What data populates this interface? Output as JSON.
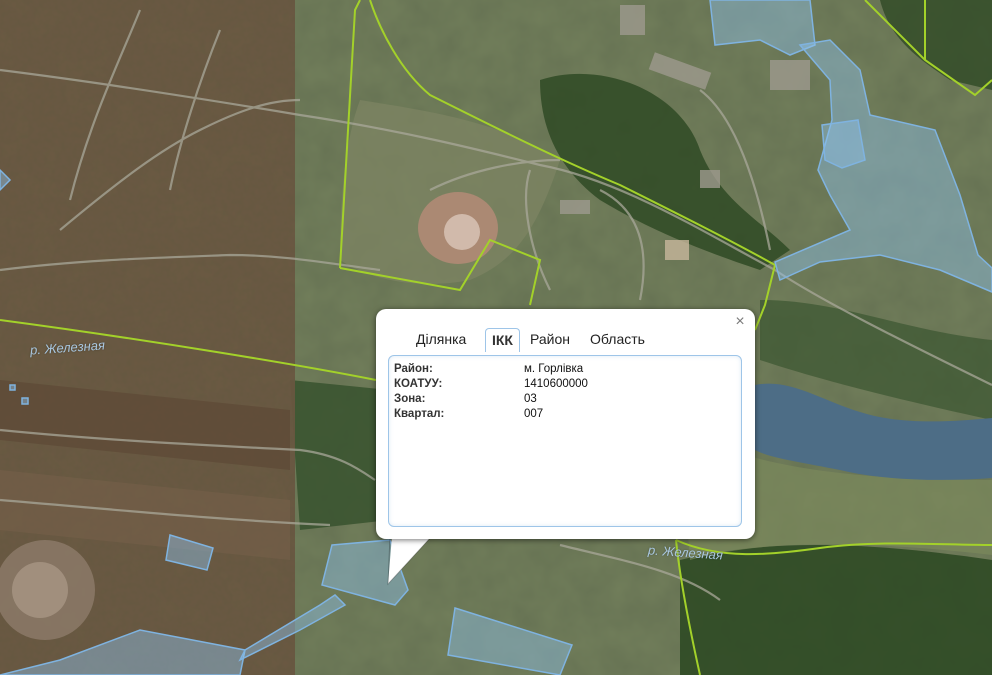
{
  "map": {
    "river_labels": [
      "р. Железная",
      "р. Железная"
    ],
    "colors": {
      "boundary_line": "#a3d12a",
      "parcel_fill": "#8fc2ea",
      "parcel_stroke": "#7fb3e0",
      "water": "#4d6d86"
    }
  },
  "popup": {
    "close_label": "×",
    "tabs": [
      {
        "label": "Ділянка",
        "active": false
      },
      {
        "label": "ІКК",
        "active": true
      },
      {
        "label": "Район",
        "active": false
      },
      {
        "label": "Область",
        "active": false
      }
    ],
    "rows": [
      {
        "label": "Район:",
        "value": "м. Горлівка"
      },
      {
        "label": "КОАТУУ:",
        "value": "1410600000"
      },
      {
        "label": "Зона:",
        "value": "03"
      },
      {
        "label": "Квартал:",
        "value": "007"
      }
    ]
  }
}
